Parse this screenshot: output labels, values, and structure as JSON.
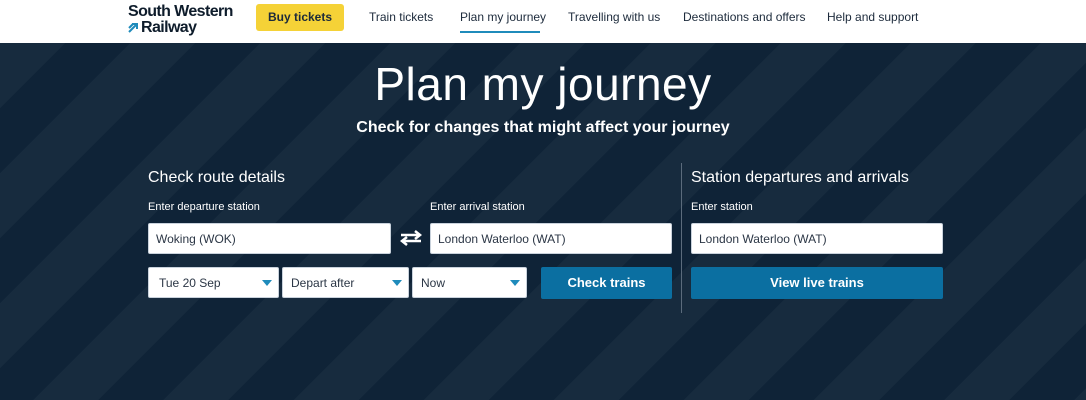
{
  "header": {
    "logo_line1": "South Western",
    "logo_line2": "Railway",
    "buy_label": "Buy tickets",
    "nav": [
      {
        "label": "Train tickets"
      },
      {
        "label": "Plan my journey"
      },
      {
        "label": "Travelling with us"
      },
      {
        "label": "Destinations and offers"
      },
      {
        "label": "Help and support"
      }
    ],
    "active_nav": "Plan my journey"
  },
  "hero": {
    "title": "Plan my journey",
    "subtitle": "Check for changes that might affect your journey"
  },
  "route": {
    "heading": "Check route details",
    "departure_label": "Enter departure station",
    "departure_value": "Woking (WOK)",
    "arrival_label": "Enter arrival station",
    "arrival_value": "London Waterloo (WAT)",
    "date_value": "Tue 20 Sep",
    "depart_mode_value": "Depart after",
    "time_value": "Now",
    "check_label": "Check trains"
  },
  "station": {
    "heading": "Station departures and arrivals",
    "station_label": "Enter station",
    "station_value": "London Waterloo (WAT)",
    "view_label": "View live trains"
  },
  "colors": {
    "hero_bg": "#0f2337",
    "buy_button": "#f5d237",
    "primary_button": "#0b6fa1",
    "accent": "#1f8bbb"
  },
  "icons": {
    "logo_mark": "arrow-logo-icon",
    "swap": "swap-arrows-icon",
    "caret": "chevron-down-icon"
  }
}
